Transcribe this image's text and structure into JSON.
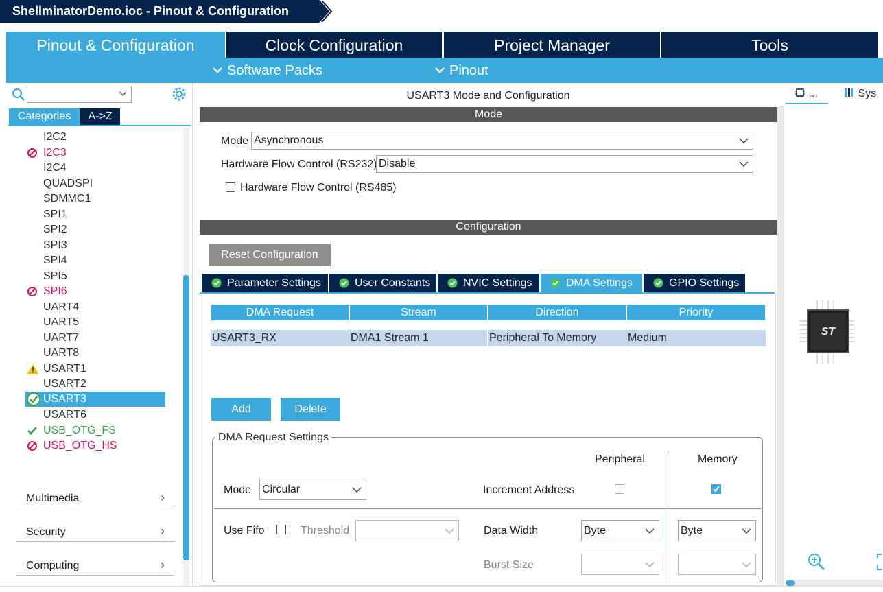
{
  "window": {
    "title": "ShellminatorDemo.ioc - Pinout & Configuration"
  },
  "top_tabs": [
    {
      "label": "Pinout & Configuration",
      "active": true
    },
    {
      "label": "Clock Configuration",
      "active": false
    },
    {
      "label": "Project Manager",
      "active": false
    },
    {
      "label": "Tools",
      "active": false
    }
  ],
  "subbar": {
    "software_packs": "Software Packs",
    "pinout": "Pinout"
  },
  "left": {
    "search_placeholder": "",
    "tabs": {
      "categories": "Categories",
      "atoz": "A->Z"
    },
    "peripherals": [
      {
        "label": "I2C2",
        "status": "none"
      },
      {
        "label": "I2C3",
        "status": "disabled"
      },
      {
        "label": "I2C4",
        "status": "none"
      },
      {
        "label": "QUADSPI",
        "status": "none"
      },
      {
        "label": "SDMMC1",
        "status": "none"
      },
      {
        "label": "SPI1",
        "status": "none"
      },
      {
        "label": "SPI2",
        "status": "none"
      },
      {
        "label": "SPI3",
        "status": "none"
      },
      {
        "label": "SPI4",
        "status": "none"
      },
      {
        "label": "SPI5",
        "status": "none"
      },
      {
        "label": "SPI6",
        "status": "disabled"
      },
      {
        "label": "UART4",
        "status": "none"
      },
      {
        "label": "UART5",
        "status": "none"
      },
      {
        "label": "UART7",
        "status": "none"
      },
      {
        "label": "UART8",
        "status": "none"
      },
      {
        "label": "USART1",
        "status": "warning"
      },
      {
        "label": "USART2",
        "status": "none"
      },
      {
        "label": "USART3",
        "status": "configured-selected"
      },
      {
        "label": "USART6",
        "status": "none"
      },
      {
        "label": "USB_OTG_FS",
        "status": "enabled"
      },
      {
        "label": "USB_OTG_HS",
        "status": "disabled"
      }
    ],
    "groups": [
      "Multimedia",
      "Security",
      "Computing"
    ]
  },
  "middle": {
    "title": "USART3 Mode and Configuration",
    "mode_section": "Mode",
    "mode_label": "Mode",
    "mode_value": "Asynchronous",
    "hfc232_label": "Hardware Flow Control (RS232)",
    "hfc232_value": "Disable",
    "hfc485_label": "Hardware Flow Control (RS485)",
    "hfc485_checked": false,
    "config_section": "Configuration",
    "reset_button": "Reset Configuration",
    "config_tabs": [
      {
        "label": "Parameter Settings",
        "active": false
      },
      {
        "label": "User Constants",
        "active": false
      },
      {
        "label": "NVIC Settings",
        "active": false
      },
      {
        "label": "DMA Settings",
        "active": true
      },
      {
        "label": "GPIO Settings",
        "active": false
      }
    ],
    "dma_table": {
      "headers": [
        "DMA Request",
        "Stream",
        "Direction",
        "Priority"
      ],
      "rows": [
        [
          "USART3_RX",
          "DMA1 Stream 1",
          "Peripheral To Memory",
          "Medium"
        ]
      ]
    },
    "add_button": "Add",
    "delete_button": "Delete",
    "dma_settings": {
      "legend": "DMA Request Settings",
      "peripheral_col": "Peripheral",
      "memory_col": "Memory",
      "mode_label": "Mode",
      "mode_value": "Circular",
      "increment_label": "Increment Address",
      "increment_peripheral": false,
      "increment_memory": true,
      "fifo_label": "Use Fifo",
      "fifo_checked": false,
      "threshold_label": "Threshold",
      "threshold_value": "",
      "data_width_label": "Data Width",
      "data_width_peripheral": "Byte",
      "data_width_memory": "Byte",
      "burst_label": "Burst Size",
      "burst_peripheral": "",
      "burst_memory": ""
    }
  },
  "right": {
    "tabs": [
      {
        "label": "...",
        "icon": "chip-view-icon"
      },
      {
        "label": "Sys",
        "icon": "system-view-icon"
      }
    ],
    "chip_logo": "ST"
  },
  "colors": {
    "navy": "#03234b",
    "accent": "#3caadc",
    "section_gray": "#585858",
    "error": "#d4145a",
    "ok": "#3da34a",
    "warning": "#f5c400"
  }
}
